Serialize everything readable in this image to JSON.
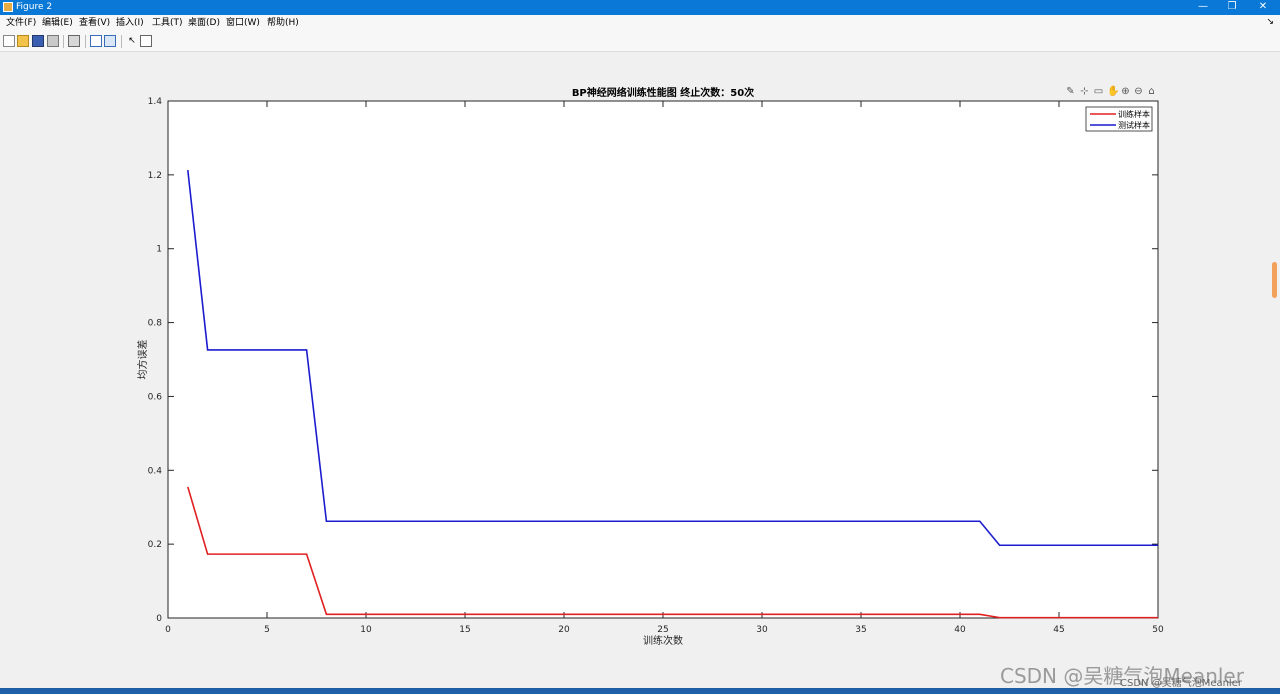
{
  "window": {
    "title": "Figure 2",
    "minimize": "—",
    "restore": "❐",
    "close": "✕"
  },
  "menu": {
    "items": [
      "文件(F)",
      "编辑(E)",
      "查看(V)",
      "插入(I)",
      "工具(T)",
      "桌面(D)",
      "窗口(W)",
      "帮助(H)"
    ],
    "right_arrow": "↘"
  },
  "axes_toolbar": [
    "brush-icon",
    "data-cursor-icon",
    "edit-icon",
    "pan-icon",
    "zoom-in-icon",
    "zoom-out-icon",
    "home-icon"
  ],
  "colors": {
    "train": "#e02020",
    "test": "#1c1ccf",
    "titlebar": "#0a78d7"
  },
  "chart_data": {
    "type": "line",
    "title": "BP神经网络训练性能图  终止次数：50次",
    "xlabel": "训练次数",
    "ylabel": "均方误差",
    "xlim": [
      0,
      50
    ],
    "ylim": [
      0,
      1.4
    ],
    "xticks": [
      0,
      5,
      10,
      15,
      20,
      25,
      30,
      35,
      40,
      45,
      50
    ],
    "yticks": [
      0,
      0.2,
      0.4,
      0.6,
      0.8,
      1,
      1.2,
      1.4
    ],
    "legend": "top-right",
    "series": [
      {
        "name": "训练样本",
        "color": "#e02020",
        "x": [
          1,
          2,
          7,
          8,
          41,
          42,
          50
        ],
        "y": [
          0.355,
          0.173,
          0.173,
          0.01,
          0.01,
          0.001,
          0.001
        ]
      },
      {
        "name": "测试样本",
        "color": "#1c1ccf",
        "x": [
          1,
          2,
          7,
          8,
          41,
          42,
          50
        ],
        "y": [
          1.213,
          0.726,
          0.726,
          0.262,
          0.262,
          0.197,
          0.197
        ]
      }
    ]
  },
  "watermark": {
    "main": "CSDN @吴糖气泡Meanler",
    "sub": "CSDN @吴糖气泡Meanler"
  }
}
